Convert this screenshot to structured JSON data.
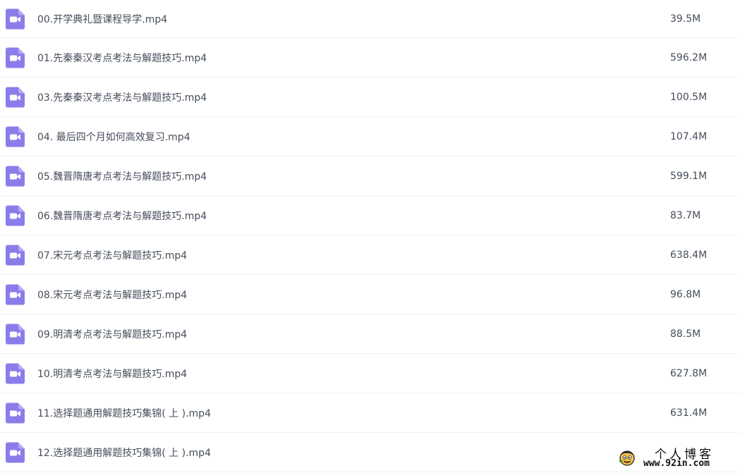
{
  "theme": {
    "icon_color": "#8a7dea",
    "text_color": "#454d5a",
    "divider": "#f1f2f4"
  },
  "files": [
    {
      "name": "00.开学典礼暨课程导学.mp4",
      "size": "39.5M",
      "icon": "video-file-icon"
    },
    {
      "name": "01.先秦秦汉考点考法与解题技巧.mp4",
      "size": "596.2M",
      "icon": "video-file-icon"
    },
    {
      "name": "03.先秦秦汉考点考法与解题技巧.mp4",
      "size": "100.5M",
      "icon": "video-file-icon"
    },
    {
      "name": "04. 最后四个月如何高效复习.mp4",
      "size": "107.4M",
      "icon": "video-file-icon"
    },
    {
      "name": "05.魏晋隋唐考点考法与解题技巧.mp4",
      "size": "599.1M",
      "icon": "video-file-icon"
    },
    {
      "name": "06.魏晋隋唐考点考法与解题技巧.mp4",
      "size": "83.7M",
      "icon": "video-file-icon"
    },
    {
      "name": "07.宋元考点考法与解题技巧.mp4",
      "size": "638.4M",
      "icon": "video-file-icon"
    },
    {
      "name": "08.宋元考点考法与解题技巧.mp4",
      "size": "96.8M",
      "icon": "video-file-icon"
    },
    {
      "name": "09.明清考点考法与解题技巧.mp4",
      "size": "88.5M",
      "icon": "video-file-icon"
    },
    {
      "name": "10.明清考点考法与解题技巧.mp4",
      "size": "627.8M",
      "icon": "video-file-icon"
    },
    {
      "name": "11.选择题通用解题技巧集锦( 上 ).mp4",
      "size": "631.4M",
      "icon": "video-file-icon"
    },
    {
      "name": "12.选择题通用解题技巧集锦( 上 ).mp4",
      "size": "",
      "icon": "video-file-icon"
    }
  ],
  "watermark": {
    "title": "个人博客",
    "url": "www.92in.com",
    "logo_icon": "cartoon-face-logo-icon"
  }
}
